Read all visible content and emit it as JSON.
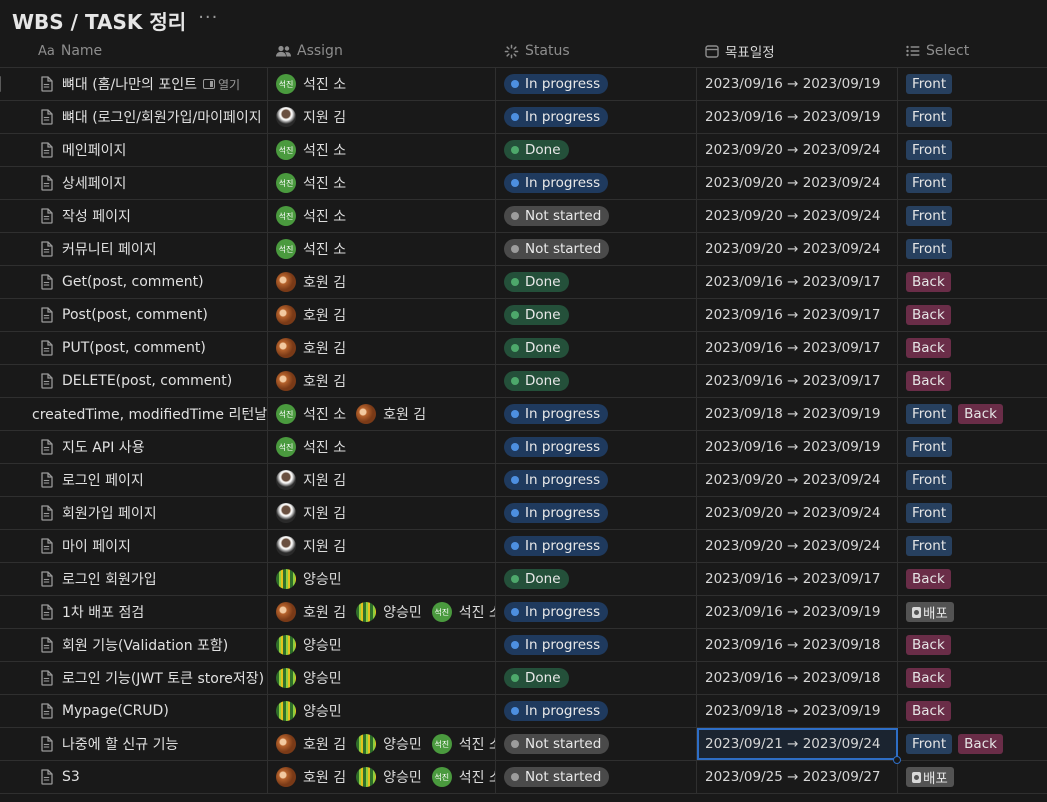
{
  "page": {
    "title": "WBS / TASK 정리",
    "more_label": "···"
  },
  "columns": {
    "name": {
      "icon": "Aa",
      "label": "Name"
    },
    "assign": {
      "icon": "people-icon",
      "label": "Assign"
    },
    "status": {
      "icon": "status-spinner-icon",
      "label": "Status"
    },
    "date": {
      "icon": "calendar-icon",
      "label": "목표일정"
    },
    "select": {
      "icon": "list-icon",
      "label": "Select"
    }
  },
  "people": {
    "seokjin": {
      "name": "석진 소",
      "avatar_text": "석진",
      "avatar": "green"
    },
    "jiwon": {
      "name": "지원 김",
      "avatar_text": "",
      "avatar": "photo"
    },
    "howon": {
      "name": "호원 김",
      "avatar_text": "",
      "avatar": "orange"
    },
    "seungmin": {
      "name": "양승민",
      "avatar_text": "",
      "avatar": "forest"
    }
  },
  "status_labels": {
    "progress": "In progress",
    "done": "Done",
    "not": "Not started"
  },
  "select_labels": {
    "front": "Front",
    "back": "Back",
    "deploy": "배포"
  },
  "open_chip_label": "열기",
  "rows": [
    {
      "name": "뼈대 (홈/나만의 포인트 ",
      "page_icon": true,
      "open": true,
      "assign": [
        "seokjin"
      ],
      "status": "progress",
      "date": "2023/09/16 → 2023/09/19",
      "tags": [
        "front"
      ]
    },
    {
      "name": "뼈대 (로그인/회원가입/마이페이지",
      "page_icon": true,
      "assign": [
        "jiwon"
      ],
      "status": "progress",
      "date": "2023/09/16 → 2023/09/19",
      "tags": [
        "front"
      ]
    },
    {
      "name": "메인페이지",
      "page_icon": true,
      "assign": [
        "seokjin"
      ],
      "status": "done",
      "date": "2023/09/20 → 2023/09/24",
      "tags": [
        "front"
      ]
    },
    {
      "name": "상세페이지",
      "page_icon": true,
      "assign": [
        "seokjin"
      ],
      "status": "progress",
      "date": "2023/09/20 → 2023/09/24",
      "tags": [
        "front"
      ]
    },
    {
      "name": "작성 페이지",
      "page_icon": true,
      "assign": [
        "seokjin"
      ],
      "status": "not",
      "date": "2023/09/20 → 2023/09/24",
      "tags": [
        "front"
      ]
    },
    {
      "name": "커뮤니티 페이지",
      "page_icon": true,
      "assign": [
        "seokjin"
      ],
      "status": "not",
      "date": "2023/09/20 → 2023/09/24",
      "tags": [
        "front"
      ]
    },
    {
      "name": "Get(post, comment)",
      "page_icon": true,
      "assign": [
        "howon"
      ],
      "status": "done",
      "date": "2023/09/16 → 2023/09/17",
      "tags": [
        "back"
      ]
    },
    {
      "name": "Post(post, comment)",
      "page_icon": true,
      "assign": [
        "howon"
      ],
      "status": "done",
      "date": "2023/09/16 → 2023/09/17",
      "tags": [
        "back"
      ]
    },
    {
      "name": "PUT(post, comment)",
      "page_icon": true,
      "assign": [
        "howon"
      ],
      "status": "done",
      "date": "2023/09/16 → 2023/09/17",
      "tags": [
        "back"
      ]
    },
    {
      "name": "DELETE(post, comment)",
      "page_icon": true,
      "assign": [
        "howon"
      ],
      "status": "done",
      "date": "2023/09/16 → 2023/09/17",
      "tags": [
        "back"
      ]
    },
    {
      "name": "createdTime, modifiedTime 리턴날짜",
      "page_icon": false,
      "assign": [
        "seokjin",
        "howon"
      ],
      "status": "progress",
      "date": "2023/09/18 → 2023/09/19",
      "tags": [
        "front",
        "back"
      ]
    },
    {
      "name": "지도 API 사용",
      "page_icon": true,
      "assign": [
        "seokjin"
      ],
      "status": "progress",
      "date": "2023/09/16 → 2023/09/19",
      "tags": [
        "front"
      ]
    },
    {
      "name": "로그인 페이지",
      "page_icon": true,
      "assign": [
        "jiwon"
      ],
      "status": "progress",
      "date": "2023/09/20 → 2023/09/24",
      "tags": [
        "front"
      ]
    },
    {
      "name": "회원가입 페이지",
      "page_icon": true,
      "assign": [
        "jiwon"
      ],
      "status": "progress",
      "date": "2023/09/20 → 2023/09/24",
      "tags": [
        "front"
      ]
    },
    {
      "name": "마이 페이지",
      "page_icon": true,
      "assign": [
        "jiwon"
      ],
      "status": "progress",
      "date": "2023/09/20 → 2023/09/24",
      "tags": [
        "front"
      ]
    },
    {
      "name": "로그인 회원가입",
      "page_icon": true,
      "assign": [
        "seungmin"
      ],
      "status": "done",
      "date": "2023/09/16 → 2023/09/17",
      "tags": [
        "back"
      ]
    },
    {
      "name": "1차 배포 점검",
      "page_icon": true,
      "assign": [
        "howon",
        "seungmin",
        "seokjin"
      ],
      "status": "progress",
      "date": "2023/09/16 → 2023/09/19",
      "tags": [
        "deploy"
      ]
    },
    {
      "name": "회원 기능(Validation 포함)",
      "page_icon": true,
      "assign": [
        "seungmin"
      ],
      "status": "progress",
      "date": "2023/09/16 → 2023/09/18",
      "tags": [
        "back"
      ]
    },
    {
      "name": "로그인 기능(JWT 토큰 store저장)",
      "page_icon": true,
      "assign": [
        "seungmin"
      ],
      "status": "done",
      "date": "2023/09/16 → 2023/09/18",
      "tags": [
        "back"
      ]
    },
    {
      "name": "Mypage(CRUD)",
      "page_icon": true,
      "assign": [
        "seungmin"
      ],
      "status": "progress",
      "date": "2023/09/18 → 2023/09/19",
      "tags": [
        "back"
      ]
    },
    {
      "name": "나중에 할 신규 기능",
      "page_icon": true,
      "assign": [
        "howon",
        "seungmin",
        "seokjin"
      ],
      "status": "not",
      "date": "2023/09/21 → 2023/09/24",
      "tags": [
        "front",
        "back"
      ],
      "selected_date": true
    },
    {
      "name": "S3",
      "page_icon": true,
      "assign": [
        "howon",
        "seungmin",
        "seokjin"
      ],
      "status": "not",
      "date": "2023/09/25 → 2023/09/27",
      "tags": [
        "deploy"
      ]
    }
  ]
}
